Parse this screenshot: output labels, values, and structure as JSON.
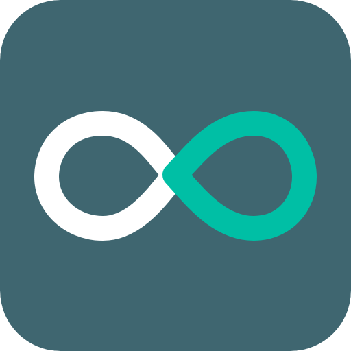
{
  "app_icon": {
    "name": "infinity-logo-app-icon",
    "background_color": "#3F6670",
    "left_loop_color": "#FFFFFF",
    "right_loop_color": "#00BFA5",
    "icon": "infinity-icon"
  }
}
